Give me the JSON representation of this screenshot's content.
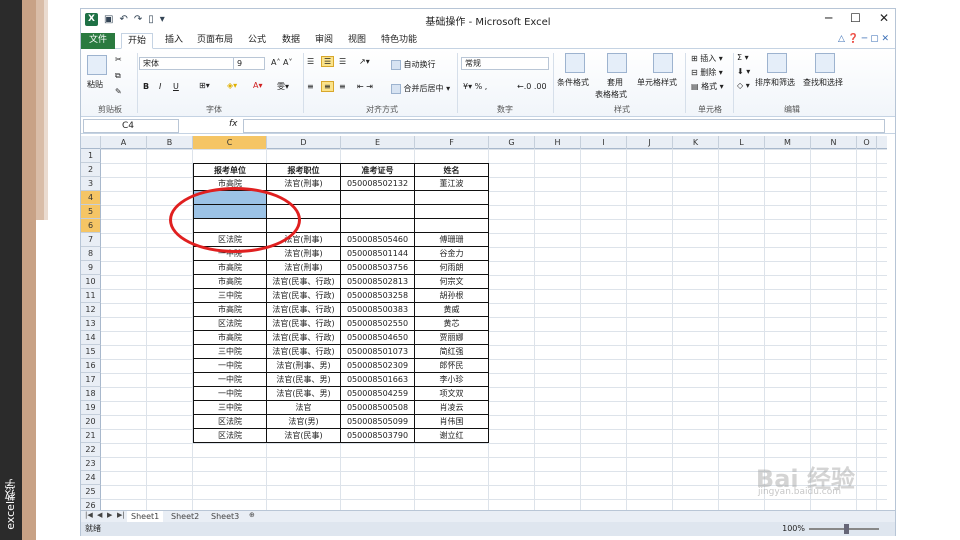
{
  "side": {
    "vertical_text": "excel教学"
  },
  "titlebar": {
    "title": "基础操作 - Microsoft Excel",
    "minimize": "─",
    "maximize": "☐",
    "close": "✕"
  },
  "tabs": [
    "文件",
    "开始",
    "插入",
    "页面布局",
    "公式",
    "数据",
    "审阅",
    "视图",
    "特色功能"
  ],
  "ribbon": {
    "paste": "粘贴",
    "clipboard": "剪贴板",
    "font_name": "宋体",
    "font_size": "9",
    "font": "字体",
    "wrap": "自动换行",
    "merge": "合并后居中",
    "alignment": "对齐方式",
    "number_format": "常规",
    "number": "数字",
    "cond_format": "条件格式",
    "table_format_1": "套用",
    "table_format_2": "表格格式",
    "cell_style": "单元格样式",
    "styles": "样式",
    "insert": "插入",
    "delete": "删除",
    "format": "格式",
    "cells": "单元格",
    "sort": "排序和筛选",
    "find": "查找和选择",
    "editing": "编辑"
  },
  "formula": {
    "name_box": "C4",
    "fx": "fx",
    "value": ""
  },
  "columns": [
    "A",
    "B",
    "C",
    "D",
    "E",
    "F",
    "G",
    "H",
    "I",
    "J",
    "K",
    "L",
    "M",
    "N",
    "O"
  ],
  "rows": [
    "1",
    "2",
    "3",
    "4",
    "5",
    "6",
    "7",
    "8",
    "9",
    "10",
    "11",
    "12",
    "13",
    "14",
    "15",
    "16",
    "17",
    "18",
    "19",
    "20",
    "21",
    "22",
    "23",
    "24",
    "25",
    "26"
  ],
  "table": {
    "headers": [
      "报考单位",
      "报考职位",
      "准考证号",
      "姓名"
    ],
    "rows": [
      [
        "市高院",
        "法官(刑事)",
        "050008502132",
        "董江波"
      ],
      [
        "",
        "",
        "",
        ""
      ],
      [
        "",
        "",
        "",
        ""
      ],
      [
        "",
        "",
        "",
        ""
      ],
      [
        "区法院",
        "法官(刑事)",
        "050008505460",
        "傅珊珊"
      ],
      [
        "一中院",
        "法官(刑事)",
        "050008501144",
        "谷金力"
      ],
      [
        "市高院",
        "法官(刑事)",
        "050008503756",
        "何雨朗"
      ],
      [
        "市高院",
        "法官(民事、行政)",
        "050008502813",
        "何宗文"
      ],
      [
        "三中院",
        "法官(民事、行政)",
        "050008503258",
        "胡孙根"
      ],
      [
        "市高院",
        "法官(民事、行政)",
        "050008500383",
        "黄威"
      ],
      [
        "区法院",
        "法官(民事、行政)",
        "050008502550",
        "黄芯"
      ],
      [
        "市高院",
        "法官(民事、行政)",
        "050008504650",
        "贾丽娜"
      ],
      [
        "三中院",
        "法官(民事、行政)",
        "050008501073",
        "简红强"
      ],
      [
        "一中院",
        "法官(刑事、男)",
        "050008502309",
        "郎怀民"
      ],
      [
        "一中院",
        "法官(民事、男)",
        "050008501663",
        "李小珍"
      ],
      [
        "一中院",
        "法官(民事、男)",
        "050008504259",
        "项文双"
      ],
      [
        "三中院",
        "法官",
        "050008500508",
        "肖凌云"
      ],
      [
        "区法院",
        "法官(男)",
        "050008505099",
        "肖伟国"
      ],
      [
        "区法院",
        "法官(民事)",
        "050008503790",
        "谢立红"
      ]
    ]
  },
  "sheets": [
    "Sheet1",
    "Sheet2",
    "Sheet3"
  ],
  "status": {
    "ready": "就绪",
    "zoom": "100%"
  },
  "watermark": {
    "main": "Bai 经验",
    "sub": "jingyan.baidu.com"
  }
}
